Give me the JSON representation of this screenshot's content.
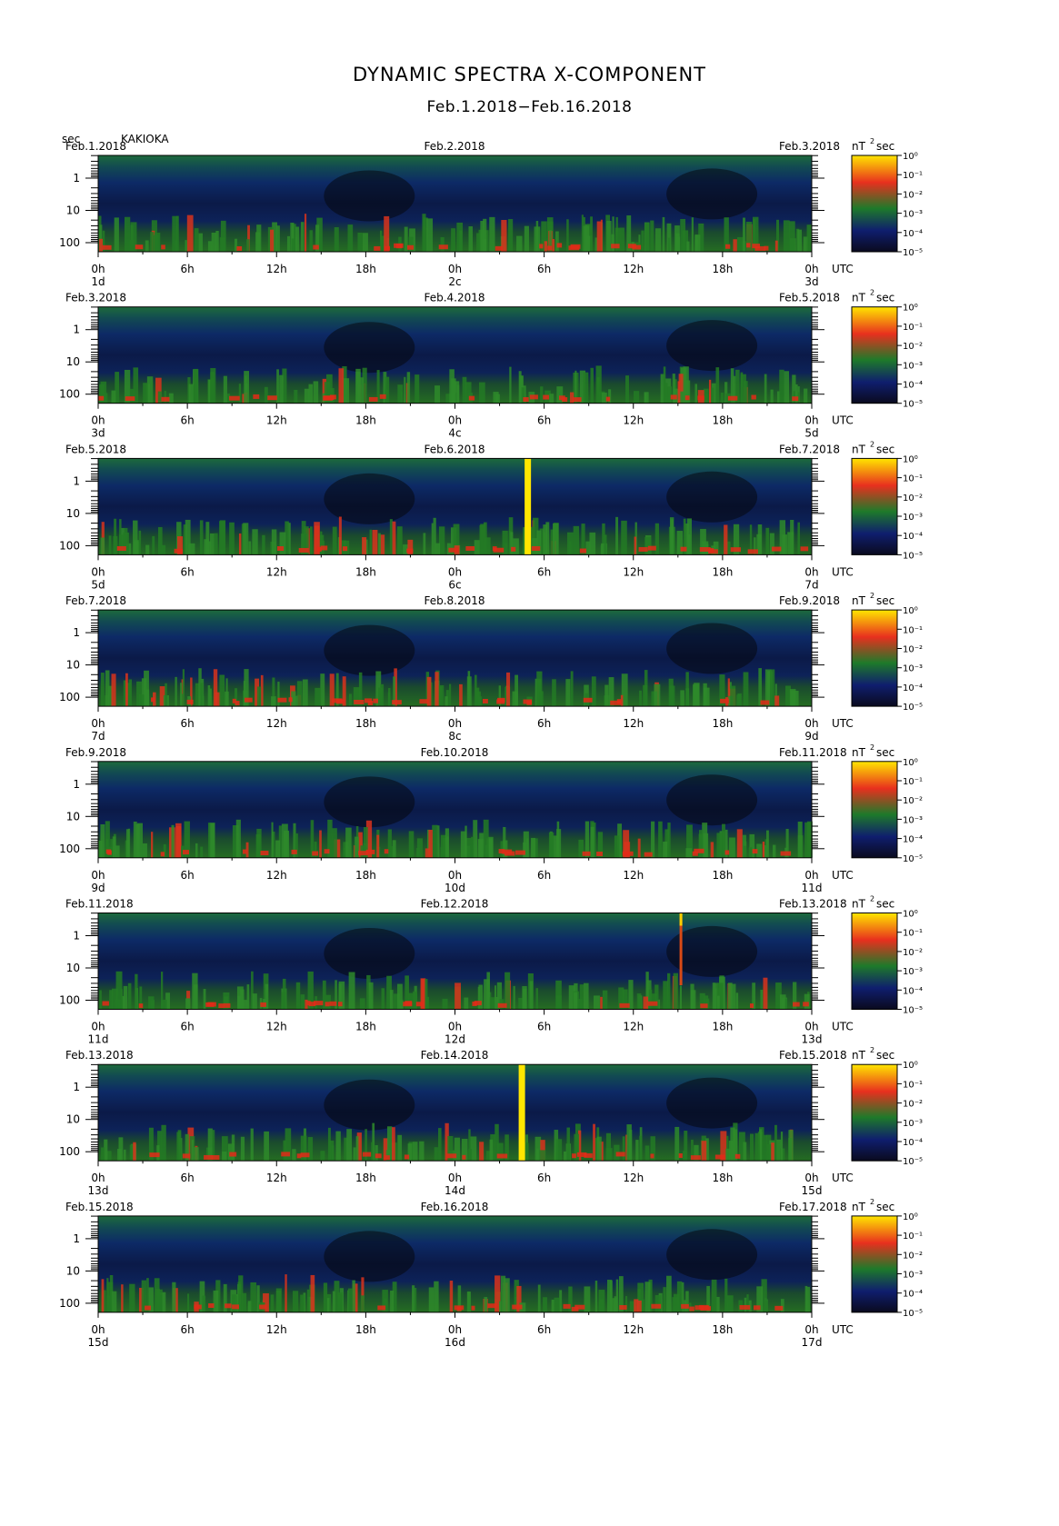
{
  "title": "DYNAMIC SPECTRA X-COMPONENT",
  "subtitle": "Feb.1.2018−Feb.16.2018",
  "period_unit": "sec",
  "station": "KAKIOKA",
  "colors": {
    "background": "#ffffff",
    "colormap": [
      "#0a0a1e",
      "#0f1e6e",
      "#1e7a2a",
      "#e8301e",
      "#ffe600"
    ]
  },
  "chart_data": {
    "type": "heatmap",
    "x_ticks": [
      "0h",
      "6h",
      "12h",
      "18h",
      "0h",
      "6h",
      "12h",
      "18h",
      "0h"
    ],
    "x_unit_label": "UTC",
    "y_ticks": [
      "1",
      "10",
      "100"
    ],
    "y_scale": "log",
    "y_unit": "sec",
    "colorbar": {
      "unit": "nT²sec",
      "scale": "log",
      "ticks": [
        "10⁰",
        "10⁻¹",
        "10⁻²",
        "10⁻³",
        "10⁻⁴",
        "10⁻⁵"
      ]
    },
    "panels": [
      {
        "left_date": "Feb.1.2018",
        "mid_date": "Feb.2.2018",
        "right_date": "Feb.3.2018",
        "day_labels": [
          "1d",
          "2c",
          "3d"
        ],
        "spikes": []
      },
      {
        "left_date": "Feb.3.2018",
        "mid_date": "Feb.4.2018",
        "right_date": "Feb.5.2018",
        "day_labels": [
          "3d",
          "4c",
          "5d"
        ],
        "spikes": []
      },
      {
        "left_date": "Feb.5.2018",
        "mid_date": "Feb.6.2018",
        "right_date": "Feb.7.2018",
        "day_labels": [
          "5d",
          "6c",
          "7d"
        ],
        "spikes": [
          {
            "utc_hours": 28.9,
            "kind": "yellow-band"
          }
        ]
      },
      {
        "left_date": "Feb.7.2018",
        "mid_date": "Feb.8.2018",
        "right_date": "Feb.9.2018",
        "day_labels": [
          "7d",
          "8c",
          "9d"
        ],
        "spikes": []
      },
      {
        "left_date": "Feb.9.2018",
        "mid_date": "Feb.10.2018",
        "right_date": "Feb.11.2018",
        "day_labels": [
          "9d",
          "10d",
          "11d"
        ],
        "spikes": []
      },
      {
        "left_date": "Feb.11.2018",
        "mid_date": "Feb.12.2018",
        "right_date": "Feb.13.2018",
        "day_labels": [
          "11d",
          "12d",
          "13d"
        ],
        "spikes": [
          {
            "utc_hours": 39.2,
            "kind": "thin-spike"
          }
        ]
      },
      {
        "left_date": "Feb.13.2018",
        "mid_date": "Feb.14.2018",
        "right_date": "Feb.15.2018",
        "day_labels": [
          "13d",
          "14d",
          "15d"
        ],
        "spikes": [
          {
            "utc_hours": 28.5,
            "kind": "yellow-band"
          }
        ]
      },
      {
        "left_date": "Feb.15.2018",
        "mid_date": "Feb.16.2018",
        "right_date": "Feb.17.2018",
        "day_labels": [
          "15d",
          "16d",
          "17d"
        ],
        "spikes": []
      }
    ]
  }
}
